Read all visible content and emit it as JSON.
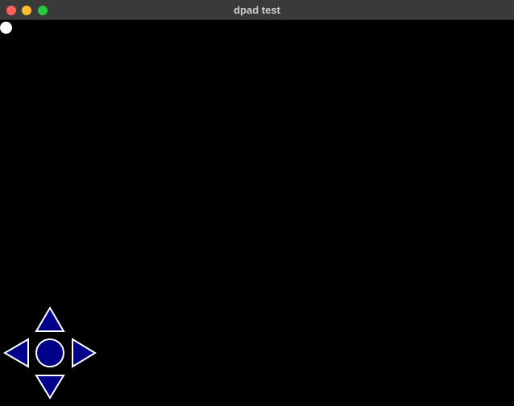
{
  "window": {
    "title": "dpad test",
    "traffic_lights": {
      "close_color": "#ff5f57",
      "minimize_color": "#febc2e",
      "maximize_color": "#28c840"
    }
  },
  "canvas": {
    "background": "#000000",
    "ball_color": "#ffffff"
  },
  "dpad": {
    "fill_color": "#00008b",
    "stroke_color": "#ffffff",
    "buttons": [
      "up-arrow-icon",
      "down-arrow-icon",
      "left-arrow-icon",
      "right-arrow-icon",
      "center-button"
    ]
  }
}
